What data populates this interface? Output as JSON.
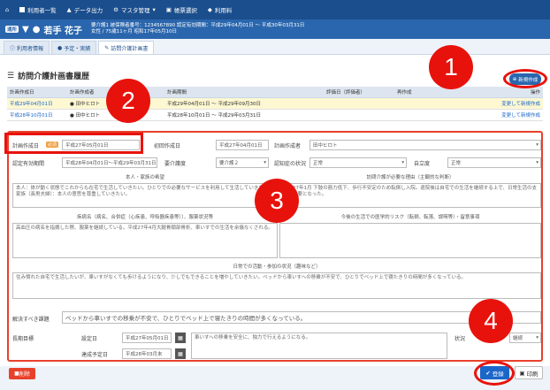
{
  "nav": {
    "items": [
      "利用者一覧",
      "データ出力",
      "マスタ管理",
      "帳票選択",
      "利用料"
    ]
  },
  "user": {
    "tag": "通所",
    "name": "若手 花子",
    "info_line1": "要介護1 被保険者番号：1234567890 認定有効期間：平成29年04月01日 〜 平成30年03月31日",
    "info_line2": "女性 / 75歳11ヶ月 昭和17年05月10日"
  },
  "tabs": [
    {
      "label": "利用者情報"
    },
    {
      "label": "予定・実績"
    },
    {
      "label": "訪問介護計画書"
    }
  ],
  "list": {
    "title": "訪問介護計画書履歴",
    "new_button": "新規作成",
    "columns": [
      "計画作成日",
      "計画作成者",
      "",
      "計画期間",
      "評価日（評価者）",
      "再作成",
      "操作"
    ],
    "rows": [
      {
        "date": "平成29年04月01日",
        "author": "田中ヒロト",
        "period": "平成29年04月01日 〜 平成29年09月30日",
        "action": "変更して新規作成"
      },
      {
        "date": "平成28年10月01日",
        "author": "田中ヒロト",
        "period": "平成28年10月01日 〜 平成29年03月31日",
        "action": "変更して新規作成"
      }
    ]
  },
  "form": {
    "plan_date_label": "計画作成日",
    "required": "必須",
    "plan_date_value": "平成27年05月01日",
    "first_date_label": "初回作成日",
    "first_date_value": "平成27年04月01日",
    "author_label": "計画作成者",
    "author_value": "田中ヒロト",
    "cert_period_label": "認定有効期間",
    "cert_period_value": "平成28年04月01日〜平成29年03月31日",
    "care_level_label": "要介護度",
    "care_level_value": "要介護２",
    "cognitive_label": "認知症の状況",
    "cognitive_value": "正常",
    "independence_label": "自立度",
    "independence_value": "正常",
    "wish_header": "本人・家族の希望",
    "wish_text": "本人：体が動く状態でこれからも在宅で生活していきたい。ひとりでの必要なサービスを利用して生活していきたい。家族（長男夫婦）：本人の意思を尊重していきたい。",
    "reason_header": "訪問介護が必要な理由（主観的な判断）",
    "reason_text": "平成27年1月 下肢の筋力低下、歩行不安定のため転倒し入院。退院後は自宅での生活を継続する上で、日常生活の支援が必要となった。",
    "disease_header": "疾病名（病名、合併症（心疾患、呼吸器疾患等））、服薬状況等",
    "disease_text": "高血圧の病名を指摘した際、服薬を継続している。平成27年4月大腿骨頸部骨折、車いすでの生活を余儀なくされる。",
    "risk_header": "今後の生活での医学的リスク（転倒、転落、誤嚥等）・留意事項",
    "life_header": "日常での活動・参加の状況（趣味など）",
    "life_text": "住み慣れた自宅で生活したいが、車いすがなくても歩けるようになり、少しでもできることを増やしていきたい。ベッドから車いすへの移乗が不安で、ひとりでベッド上で寝たきりの時間が多くなっている。",
    "goal_label": "解決すべき課題",
    "goal_text": "ベッドから車いすでの移乗が不安で、ひとりでベッド上で寝たきりの時間が多くなっている。",
    "long_goal_label": "長期目標",
    "set_date_label": "設定日",
    "set_date_value": "平成27年05月01日",
    "achieve_label": "達成予定日",
    "achieve_value": "平成28年03月末",
    "long_goal_text": "車いすへの移乗を安全に、独力で行えるようになる。",
    "status_label": "状況",
    "status_value": "継続"
  },
  "buttons": {
    "delete": "削除",
    "save": "登録",
    "print": "印刷"
  },
  "callouts": [
    "1",
    "2",
    "3",
    "4"
  ]
}
